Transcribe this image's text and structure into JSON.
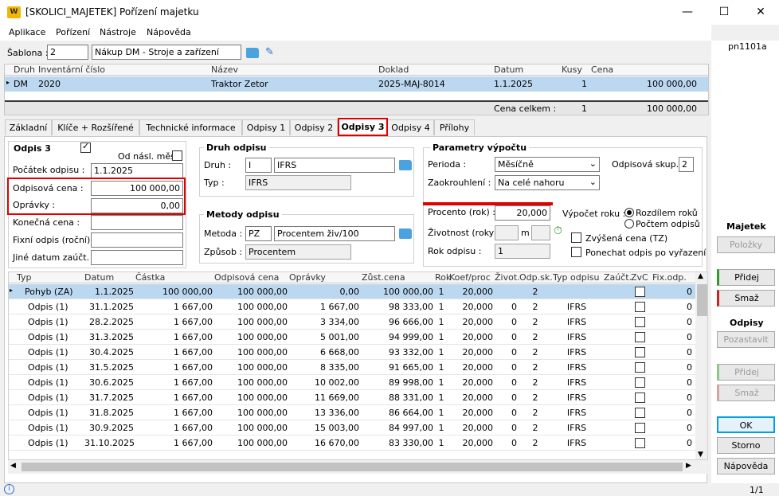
{
  "window": {
    "title": "[SKOLICI_MAJETEK] Pořízení majetku",
    "code": "pn1101a"
  },
  "menu": [
    "Aplikace",
    "Pořízení",
    "Nástroje",
    "Nápověda"
  ],
  "template": {
    "label": "Šablona :",
    "num": "2",
    "name": "Nákup DM - Stroje a zařízení"
  },
  "asset_table": {
    "headers": [
      "Druh",
      "Inventární číslo",
      "Název",
      "Doklad",
      "Datum",
      "Kusy",
      "Cena"
    ],
    "row": [
      "DM",
      "2020",
      "Traktor Zetor",
      "2025-MAJ-8014",
      "1.1.2025",
      "1",
      "100 000,00"
    ],
    "total_label": "Cena celkem :",
    "total_qty": "1",
    "total_price": "100 000,00"
  },
  "tabs": [
    "Základní",
    "Klíče + Rozšířené",
    "Technické informace",
    "Odpisy 1",
    "Odpisy 2",
    "Odpisy 3",
    "Odpisy 4",
    "Přílohy"
  ],
  "odpis": {
    "title": "Odpis 3",
    "next_label": "Od násl. měs.",
    "start_label": "Počátek odpisu :",
    "start": "1.1.2025",
    "cost_label": "Odpisová cena :",
    "cost": "100 000,00",
    "adj_label": "Oprávky :",
    "adj": "0,00",
    "final_label": "Konečná cena :",
    "fixed_label": "Fixní odpis (roční) :",
    "other_label": "Jiné datum zaúčt. :"
  },
  "druh": {
    "title": "Druh odpisu",
    "druh_label": "Druh :",
    "druh_code": "I",
    "druh_name": "IFRS",
    "typ_label": "Typ :",
    "typ": "IFRS"
  },
  "metody": {
    "title": "Metody odpisu",
    "metoda_label": "Metoda :",
    "metoda_code": "PZ",
    "metoda_name": "Procentem živ/100",
    "zpusob_label": "Způsob :",
    "zpusob": "Procentem"
  },
  "params": {
    "title": "Parametry výpočtu",
    "perioda_label": "Perioda :",
    "perioda": "Měsíčně",
    "zaokr_label": "Zaokrouhlení :",
    "zaokr": "Na celé nahoru",
    "skup_label": "Odpisová skup. :",
    "skup": "2",
    "pct_label": "Procento (rok) :",
    "pct": "20,000",
    "zivot_label": "Životnost (roky) :",
    "zivot_m": "m",
    "rok_label": "Rok odpisu :",
    "rok": "1",
    "vypocet_label": "Výpočet roku :",
    "radio1": "Rozdílem roků",
    "radio2": "Počtem odpisů",
    "cb1": "Zvýšená cena (TZ)",
    "cb2": "Ponechat odpis po vyřazení"
  },
  "grid": {
    "headers": [
      "Typ",
      "Datum",
      "Částka",
      "Odpisová cena",
      "Oprávky",
      "Zůst.cena",
      "Rok",
      "Koef/proc",
      "Život.",
      "Odp.sk.",
      "Typ odpisu",
      "Zaúčt.",
      "ZvC",
      "Fix.odp."
    ],
    "rows": [
      [
        "Pohyb (ZA)",
        "1.1.2025",
        "100 000,00",
        "100 000,00",
        "0,00",
        "100 000,00",
        "1",
        "20,000",
        "",
        "2",
        "",
        "",
        "",
        "0"
      ],
      [
        "Odpis (1)",
        "31.1.2025",
        "1 667,00",
        "100 000,00",
        "1 667,00",
        "98 333,00",
        "1",
        "20,000",
        "0",
        "2",
        "IFRS",
        "",
        "",
        "0"
      ],
      [
        "Odpis (1)",
        "28.2.2025",
        "1 667,00",
        "100 000,00",
        "3 334,00",
        "96 666,00",
        "1",
        "20,000",
        "0",
        "2",
        "IFRS",
        "",
        "",
        "0"
      ],
      [
        "Odpis (1)",
        "31.3.2025",
        "1 667,00",
        "100 000,00",
        "5 001,00",
        "94 999,00",
        "1",
        "20,000",
        "0",
        "2",
        "IFRS",
        "",
        "",
        "0"
      ],
      [
        "Odpis (1)",
        "30.4.2025",
        "1 667,00",
        "100 000,00",
        "6 668,00",
        "93 332,00",
        "1",
        "20,000",
        "0",
        "2",
        "IFRS",
        "",
        "",
        "0"
      ],
      [
        "Odpis (1)",
        "31.5.2025",
        "1 667,00",
        "100 000,00",
        "8 335,00",
        "91 665,00",
        "1",
        "20,000",
        "0",
        "2",
        "IFRS",
        "",
        "",
        "0"
      ],
      [
        "Odpis (1)",
        "30.6.2025",
        "1 667,00",
        "100 000,00",
        "10 002,00",
        "89 998,00",
        "1",
        "20,000",
        "0",
        "2",
        "IFRS",
        "",
        "",
        "0"
      ],
      [
        "Odpis (1)",
        "31.7.2025",
        "1 667,00",
        "100 000,00",
        "11 669,00",
        "88 331,00",
        "1",
        "20,000",
        "0",
        "2",
        "IFRS",
        "",
        "",
        "0"
      ],
      [
        "Odpis (1)",
        "31.8.2025",
        "1 667,00",
        "100 000,00",
        "13 336,00",
        "86 664,00",
        "1",
        "20,000",
        "0",
        "2",
        "IFRS",
        "",
        "",
        "0"
      ],
      [
        "Odpis (1)",
        "30.9.2025",
        "1 667,00",
        "100 000,00",
        "15 003,00",
        "84 997,00",
        "1",
        "20,000",
        "0",
        "2",
        "IFRS",
        "",
        "",
        "0"
      ],
      [
        "Odpis (1)",
        "31.10.2025",
        "1 667,00",
        "100 000,00",
        "16 670,00",
        "83 330,00",
        "1",
        "20,000",
        "0",
        "2",
        "IFRS",
        "",
        "",
        "0"
      ]
    ]
  },
  "side": {
    "majetek": "Majetek",
    "polozky": "Položky",
    "pridej": "Přidej",
    "smaz": "Smaž",
    "odpisy": "Odpisy",
    "pozastavit": "Pozastavit",
    "pridej2": "Přidej",
    "smaz2": "Smaž",
    "ok": "OK",
    "storno": "Storno",
    "napoveda": "Nápověda"
  },
  "status": {
    "page": "1/1"
  },
  "colors": {
    "highlight": "#e00000",
    "selection": "#bcd8f0",
    "ok_border": "#00a0e0"
  }
}
